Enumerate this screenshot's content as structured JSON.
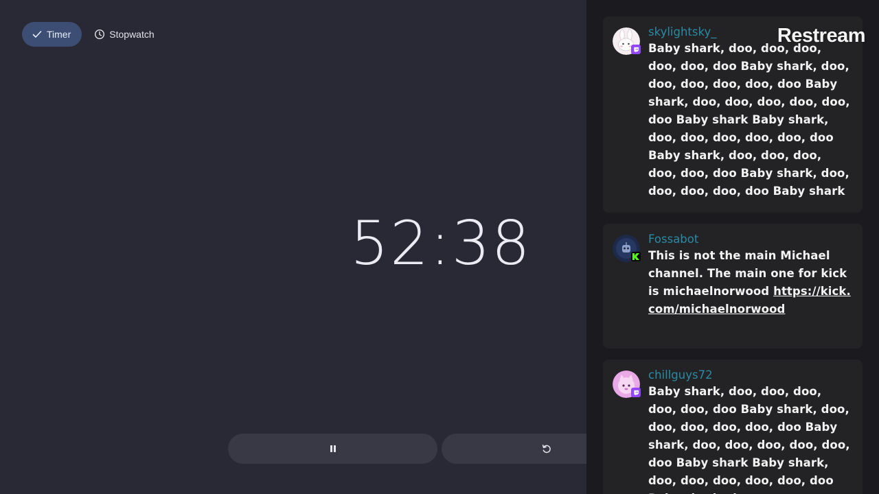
{
  "clock": {
    "tabs": [
      {
        "label": "Timer",
        "icon": "check-icon",
        "active": true
      },
      {
        "label": "Stopwatch",
        "icon": "clock-icon",
        "active": false
      }
    ],
    "time": "52:38",
    "controls": {
      "pause_icon": "pause-icon",
      "reset_icon": "reset-icon"
    }
  },
  "chat": {
    "brand": "Restream",
    "messages": [
      {
        "username": "skylightsky_",
        "platform": "twitch",
        "text": "Baby shark, doo, doo, doo, doo, doo, doo Baby shark, doo, doo, doo, doo, doo, doo Baby shark, doo, doo, doo, doo, doo, doo Baby shark Baby shark, doo, doo, doo, doo, doo, doo Baby shark, doo, doo, doo, doo, doo, doo Baby shark, doo, doo, doo, doo, doo Baby shark"
      },
      {
        "username": "Fossabot",
        "platform": "kick",
        "text": "This is not the main Michael channel. The main one for kick is michaelnorwood",
        "link": "https://kick.com/michaelnorwood"
      },
      {
        "username": "chillguys72",
        "platform": "twitch",
        "text": "Baby shark, doo, doo, doo, doo, doo, doo Baby shark, doo, doo, doo, doo, doo, doo Baby shark, doo, doo, doo, doo, doo, doo Baby shark Baby shark, doo, doo, doo, doo, doo, doo Baby shark, doo,"
      }
    ]
  },
  "colors": {
    "background": "#292935",
    "active_tab": "#3d4e75",
    "control_button": "#393945",
    "chat_panel": "#1b1b1f",
    "chat_card": "#232325",
    "username": "#2a8ba5",
    "twitch": "#9146ff",
    "kick": "#53fc18"
  }
}
